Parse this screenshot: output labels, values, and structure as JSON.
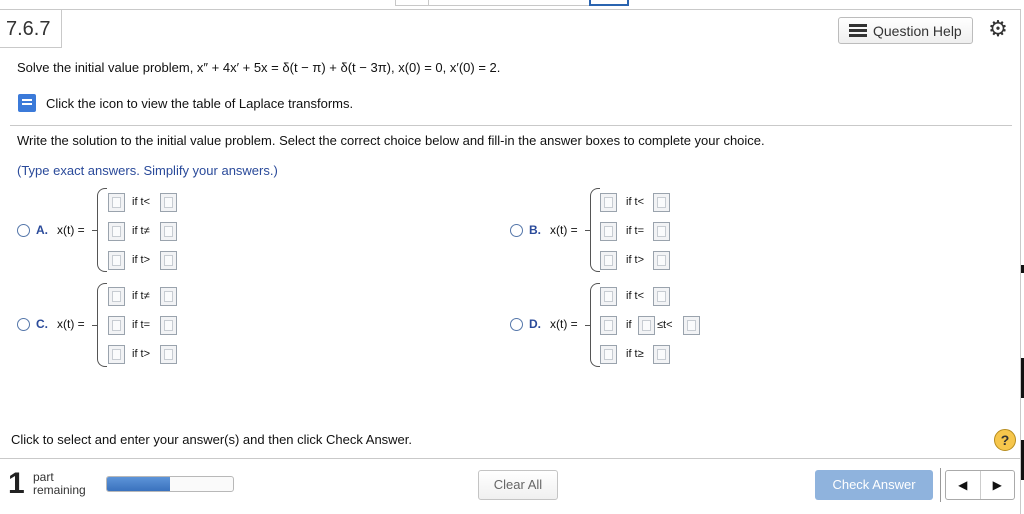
{
  "header": {
    "question_number": "7.6.7",
    "help_label": "Question Help"
  },
  "problem": {
    "statement": "Solve the initial value problem, x″ + 4x′ + 5x = δ(t − π) + δ(t − 3π),  x(0) = 0, x′(0) = 2.",
    "laplace_link": "Click the icon to view the table of Laplace transforms."
  },
  "instructions": {
    "main": "Write the solution to the initial value problem. Select the correct choice below and fill-in the answer boxes to complete your choice.",
    "note": "(Type exact answers. Simplify your answers.)"
  },
  "choices": [
    {
      "letter": "A.",
      "fx": "x(t) =",
      "conds": [
        "if t<",
        "if t≠",
        "if t>"
      ]
    },
    {
      "letter": "B.",
      "fx": "x(t) =",
      "conds": [
        "if t<",
        "if t=",
        "if t>"
      ]
    },
    {
      "letter": "C.",
      "fx": "x(t) =",
      "conds": [
        "if t≠",
        "if t=",
        "if t>"
      ]
    },
    {
      "letter": "D.",
      "fx": "x(t) =",
      "conds": [
        "if t<",
        "if",
        "≤t<",
        "if t≥"
      ]
    }
  ],
  "footer": {
    "message": "Click to select and enter your answer(s) and then click Check Answer.",
    "parts_count": "1",
    "parts_label_1": "part",
    "parts_label_2": "remaining",
    "progress_fraction": 0.5,
    "clear_label": "Clear All",
    "check_label": "Check Answer",
    "prev_symbol": "◀",
    "next_symbol": "▶",
    "help_symbol": "?"
  },
  "colors": {
    "accent": "#2a4a9a",
    "check_button": "#8fb3dd",
    "progress": "#3a72be"
  }
}
